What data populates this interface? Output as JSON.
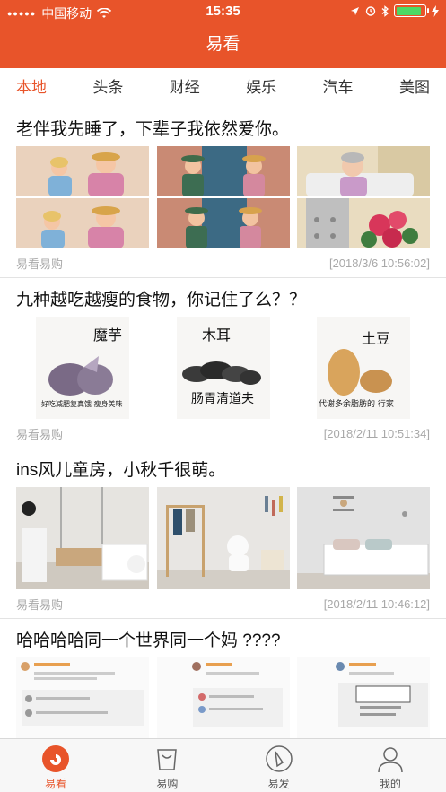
{
  "status_bar": {
    "carrier": "中国移动",
    "time": "15:35",
    "battery_level": 0.9,
    "icons": [
      "signal-icon",
      "wifi-icon",
      "location-icon",
      "alarm-icon",
      "bluetooth-icon",
      "battery-icon",
      "charging-icon"
    ]
  },
  "nav": {
    "title": "易看"
  },
  "tabs": [
    {
      "label": "本地"
    },
    {
      "label": "头条"
    },
    {
      "label": "财经"
    },
    {
      "label": "娱乐"
    },
    {
      "label": "汽车"
    },
    {
      "label": "美图"
    }
  ],
  "articles": [
    {
      "title": "老伴我先睡了，下辈子我依然爱你。",
      "source": "易看易购",
      "time": "[2018/3/6 10:56:02]",
      "images": [
        "comic-couple-panel",
        "comic-door-panel",
        "comic-bed-panel"
      ]
    },
    {
      "title": "九种越吃越瘦的食物，你记住了么？？",
      "source": "易看易购",
      "time": "[2018/2/11 10:51:34]",
      "images": [
        {
          "label": "魔芋",
          "caption": "好吃减肥复真饿 瘦身美味"
        },
        {
          "label": "木耳",
          "caption": "肠胃清道夫"
        },
        {
          "label": "土豆",
          "caption": "代谢多余脂肪的 行家"
        }
      ]
    },
    {
      "title": "ins风儿童房，小秋千很萌。",
      "source": "易看易购",
      "time": "[2018/2/11 10:46:12]",
      "images": [
        "kids-room-swing",
        "kids-room-rack",
        "kids-room-bed"
      ]
    },
    {
      "title": "哈哈哈哈同一个世界同一个妈 ????",
      "images": [
        "chat-screenshot-1",
        "chat-screenshot-2",
        "chat-screenshot-3"
      ]
    }
  ],
  "tab_bar": [
    {
      "label": "易看",
      "icon": "news-icon"
    },
    {
      "label": "易购",
      "icon": "shopping-bag-icon"
    },
    {
      "label": "易发",
      "icon": "compass-icon"
    },
    {
      "label": "我的",
      "icon": "user-icon"
    }
  ],
  "colors": {
    "accent": "#e8542a",
    "meta_text": "#a8a8a8",
    "charging_green": "#4cd964"
  }
}
